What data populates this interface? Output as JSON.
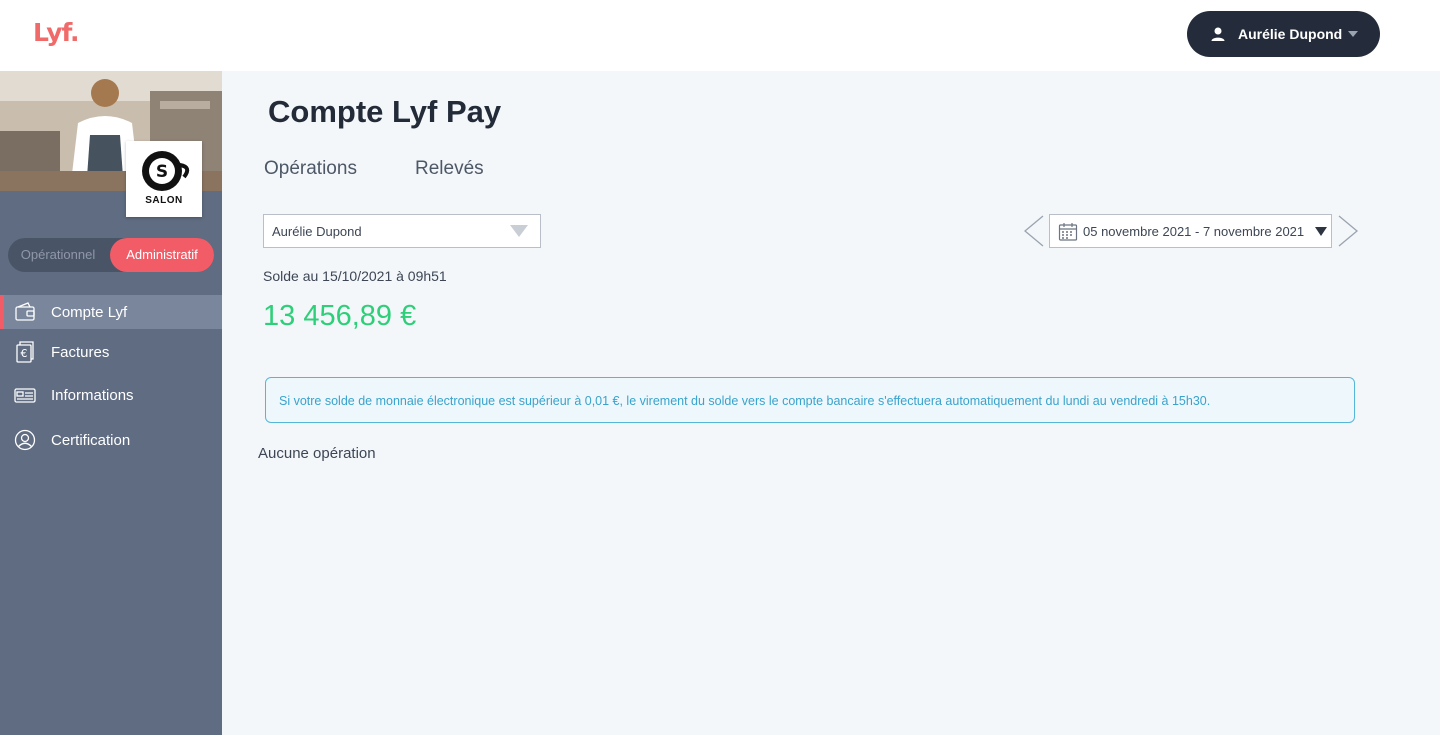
{
  "header": {
    "logo_text": "Lyf.",
    "user_name": "Aurélie Dupond"
  },
  "sidebar": {
    "brand_name": "SALON",
    "mode_toggle": {
      "options": [
        "Opérationnel",
        "Administratif"
      ],
      "selected": "Administratif"
    },
    "items": [
      {
        "label": "Compte Lyf",
        "icon": "wallet-icon",
        "active": true
      },
      {
        "label": "Factures",
        "icon": "invoice-euro-icon",
        "active": false
      },
      {
        "label": "Informations",
        "icon": "id-card-icon",
        "active": false
      },
      {
        "label": "Certification",
        "icon": "user-circle-icon",
        "active": false
      }
    ]
  },
  "main": {
    "title": "Compte Lyf Pay",
    "tabs": [
      {
        "label": "Opérations"
      },
      {
        "label": "Relevés"
      }
    ],
    "account_select": {
      "value": "Aurélie Dupond"
    },
    "balance": {
      "label": "Solde au 15/10/2021 à 09h51",
      "amount": "13 456,89 €"
    },
    "date_range": {
      "value": "05 novembre 2021 - 7 novembre 2021"
    },
    "info_message": "Si votre solde de monnaie électronique est supérieur à 0,01 €, le virement du solde vers le compte bancaire s'effectuera automatiquement du lundi au vendredi à 15h30.",
    "empty_message": "Aucune opération"
  },
  "colors": {
    "accent": "#f25c67",
    "balance_green": "#2fcf7a",
    "sidebar_bg": "#5f6c82",
    "info_blue": "#3aa3cd",
    "dark_button": "#242c3b"
  }
}
